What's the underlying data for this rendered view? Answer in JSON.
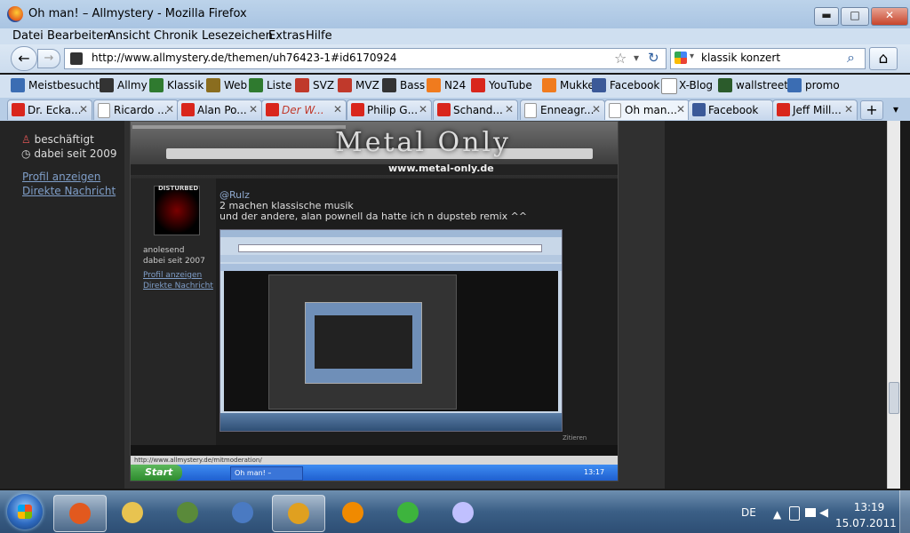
{
  "window": {
    "title": "Oh man! – Allmystery - Mozilla Firefox",
    "minimize": "▬",
    "maximize": "□",
    "close": "✕"
  },
  "menu": [
    "Datei",
    "Bearbeiten",
    "Ansicht",
    "Chronik",
    "Lesezeichen",
    "Extras",
    "Hilfe"
  ],
  "nav": {
    "url": "http://www.allmystery.de/themen/uh76423-1#id6170924",
    "star": "☆",
    "dropdown": "▾",
    "reload": "↻",
    "search_value": "klassik konzert",
    "search_dropdown": "▾",
    "home": "⌂",
    "back": "←",
    "forward": "→",
    "search_glass": "⌕"
  },
  "bookmarks": [
    {
      "label": "Meistbesucht",
      "icon": "bookmarks-icon",
      "color": "#3b6db3"
    },
    {
      "label": "Allmy",
      "icon": "pen-icon",
      "color": "#333333"
    },
    {
      "label": "Klassik",
      "icon": "app-icon",
      "color": "#2f7a2f"
    },
    {
      "label": "Web",
      "icon": "building-icon",
      "color": "#8a6d1f"
    },
    {
      "label": "Liste",
      "icon": "dollar-icon",
      "color": "#2f7a2f"
    },
    {
      "label": "SVZ",
      "icon": "burst-icon",
      "color": "#c0392b"
    },
    {
      "label": "MVZ",
      "icon": "burst-icon",
      "color": "#c0392b"
    },
    {
      "label": "Bass",
      "icon": "ukb-icon",
      "color": "#333333"
    },
    {
      "label": "N24",
      "icon": "square-icon",
      "color": "#f07b1e"
    },
    {
      "label": "YouTube",
      "icon": "youtube-icon",
      "color": "#d9261c"
    },
    {
      "label": "Mukke",
      "icon": "square-icon",
      "color": "#f07b1e"
    },
    {
      "label": "Facebook",
      "icon": "facebook-icon",
      "color": "#3b5998"
    },
    {
      "label": "X-Blog",
      "icon": "page-icon",
      "color": "#ffffff"
    },
    {
      "label": "wallstreet",
      "icon": "mo-icon",
      "color": "#2b5b2b"
    },
    {
      "label": "promo",
      "icon": "pb-icon",
      "color": "#3b6db3"
    }
  ],
  "tabs": [
    {
      "label": "Dr. Ecka...",
      "icon": "youtube"
    },
    {
      "label": "Ricardo ...",
      "icon": "doc"
    },
    {
      "label": "Alan Po...",
      "icon": "youtube"
    },
    {
      "label": "Der W...",
      "icon": "youtube"
    },
    {
      "label": "Philip G...",
      "icon": "youtube"
    },
    {
      "label": "Schand...",
      "icon": "youtube"
    },
    {
      "label": "Enneagr...",
      "icon": "doc"
    },
    {
      "label": "Oh man...",
      "icon": "doc",
      "active": true
    },
    {
      "label": "Facebook",
      "icon": "facebook"
    },
    {
      "label": "Jeff Mill...",
      "icon": "youtube"
    }
  ],
  "tab_close": "✕",
  "tab_new": "+",
  "tab_list": "▾",
  "profile": {
    "status": "beschäftigt",
    "since": "dabei seit 2009",
    "link_profile": "Profil anzeigen",
    "link_message": "Direkte Nachricht"
  },
  "nested": {
    "banner": "Metal Only",
    "banner_sub": "www.metal-only.de",
    "avatar_label": "DISTURBED",
    "post_name": "@Rulz",
    "post_line1": "2 machen klassische musik",
    "post_line2": "und der andere, alan pownell da hatte ich n dupsteb remix ^^",
    "user_status": "anolesend",
    "user_since": "dabei seit 2007",
    "link_profile": "Profil anzeigen",
    "link_message": "Direkte Nachricht",
    "status_url": "http://www.allmystery.de/mitmoderation/",
    "start": "Start",
    "task_item": "Oh man! – Allmystery...",
    "clock": "13:17",
    "quote_btn": "Zitieren"
  },
  "taskbar": {
    "apps": [
      {
        "name": "firefox-icon",
        "color": "#e2591e",
        "active": true
      },
      {
        "name": "explorer-icon",
        "color": "#e8c350"
      },
      {
        "name": "network-icon",
        "color": "#5a8a3a"
      },
      {
        "name": "thunderbird-icon",
        "color": "#4a7ac2"
      },
      {
        "name": "winamp-icon",
        "color": "#e0a020",
        "active": true
      },
      {
        "name": "vlc-icon",
        "color": "#f08a00"
      },
      {
        "name": "icq-icon",
        "color": "#3db43d"
      },
      {
        "name": "paint-icon",
        "color": "#c0c0ff"
      }
    ],
    "lang": "DE",
    "time": "13:19",
    "date": "15.07.2011"
  }
}
